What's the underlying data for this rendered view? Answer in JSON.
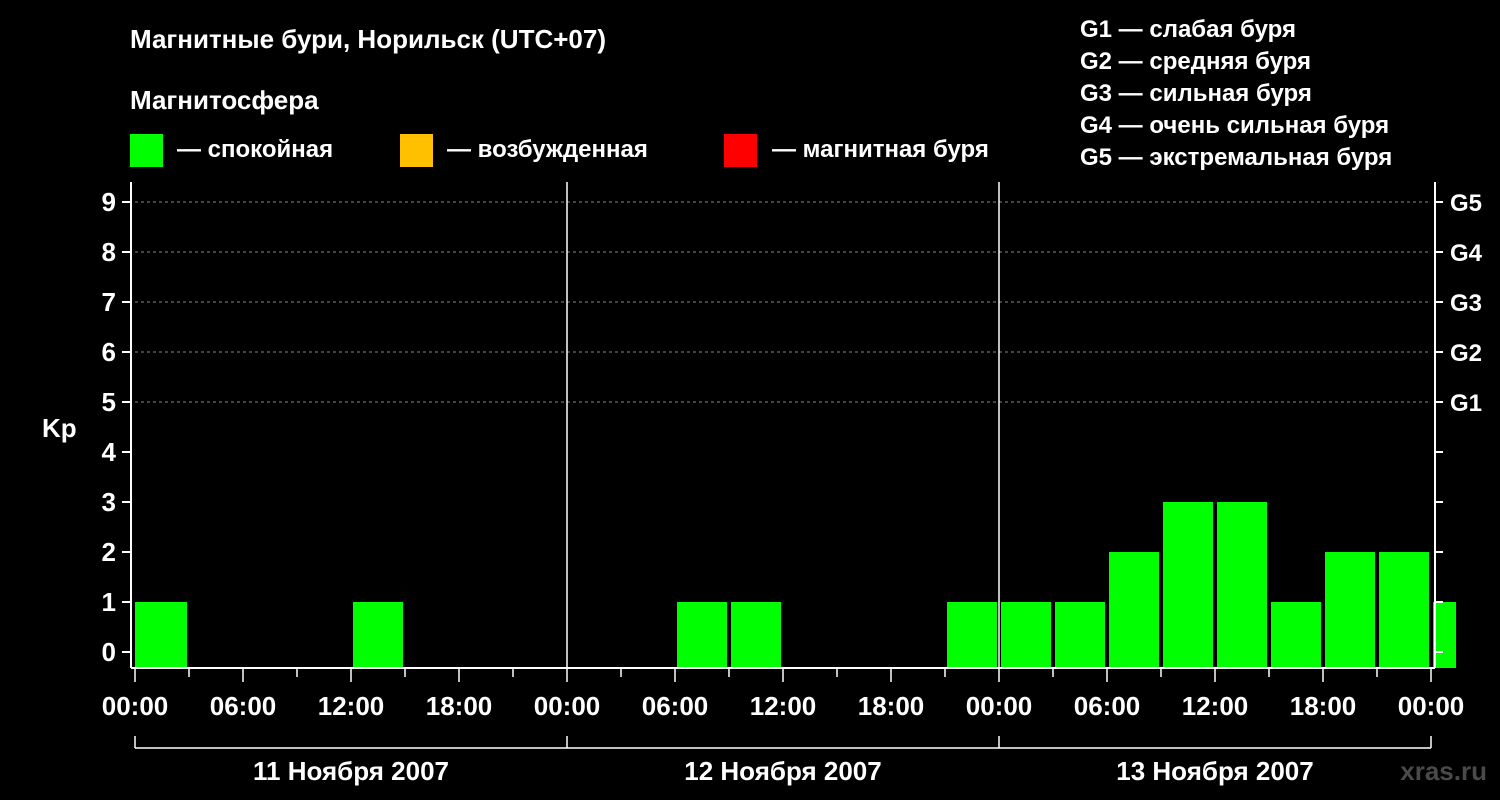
{
  "chart_data": {
    "type": "bar",
    "title": "Магнитные бури, Норильск (UTC+07)",
    "ylabel": "Kp",
    "ylim": [
      0,
      9
    ],
    "y_ticks": [
      "0",
      "1",
      "2",
      "3",
      "4",
      "5",
      "6",
      "7",
      "8",
      "9"
    ],
    "right_axis_labels": [
      {
        "kp": 5,
        "label": "G1"
      },
      {
        "kp": 6,
        "label": "G2"
      },
      {
        "kp": 7,
        "label": "G3"
      },
      {
        "kp": 8,
        "label": "G4"
      },
      {
        "kp": 9,
        "label": "G5"
      }
    ],
    "x_tick_labels": [
      "00:00",
      "06:00",
      "12:00",
      "18:00",
      "00:00",
      "06:00",
      "12:00",
      "18:00",
      "00:00",
      "06:00",
      "12:00",
      "18:00",
      "00:00"
    ],
    "days": [
      "11 Ноября 2007",
      "12 Ноября 2007",
      "13 Ноября 2007"
    ],
    "interval_hours": 3,
    "values": [
      [
        1,
        0,
        0,
        0,
        1,
        0,
        0,
        0
      ],
      [
        0,
        0,
        1,
        1,
        0,
        0,
        0,
        0
      ],
      [
        1,
        1,
        2,
        3,
        3,
        1,
        2,
        2
      ]
    ],
    "extra_bars": [
      {
        "day": 0,
        "start_hour": 0,
        "hours": 1,
        "value": 1
      },
      {
        "day": 1,
        "start_hour": 21,
        "hours": 3,
        "value": 1
      },
      {
        "day": 2,
        "start_hour": 24,
        "hours": 1.5,
        "value": 1
      }
    ],
    "legend_title": "Магнитосфера",
    "legend": [
      {
        "label": "— спокойная",
        "color": "#00ff00"
      },
      {
        "label": "— возбужденная",
        "color": "#ffc000"
      },
      {
        "label": "— магнитная буря",
        "color": "#ff0000"
      }
    ],
    "storm_levels": [
      "G1 — слабая буря",
      "G2 — средняя буря",
      "G3 — сильная буря",
      "G4 — очень сильная буря",
      "G5 — экстремальная буря"
    ],
    "grid": "dashed at Kp 5–9",
    "watermark": "xras.ru",
    "colors": {
      "background": "#000000",
      "bar": "#00ff00",
      "axis": "#ffffff",
      "grid": "#888888"
    }
  }
}
